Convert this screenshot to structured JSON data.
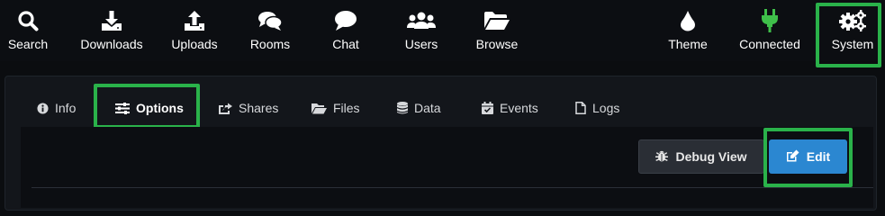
{
  "nav": {
    "search": "Search",
    "downloads": "Downloads",
    "uploads": "Uploads",
    "rooms": "Rooms",
    "chat": "Chat",
    "users": "Users",
    "browse": "Browse",
    "theme": "Theme",
    "connected": "Connected",
    "system": "System"
  },
  "tabs": {
    "info": "Info",
    "options": "Options",
    "shares": "Shares",
    "files": "Files",
    "data": "Data",
    "events": "Events",
    "logs": "Logs"
  },
  "buttons": {
    "debug_view": "Debug View",
    "edit": "Edit"
  },
  "colors": {
    "highlight": "#2ab24a",
    "connected_icon": "#3fbf4a",
    "primary_button": "#2b87d1"
  }
}
